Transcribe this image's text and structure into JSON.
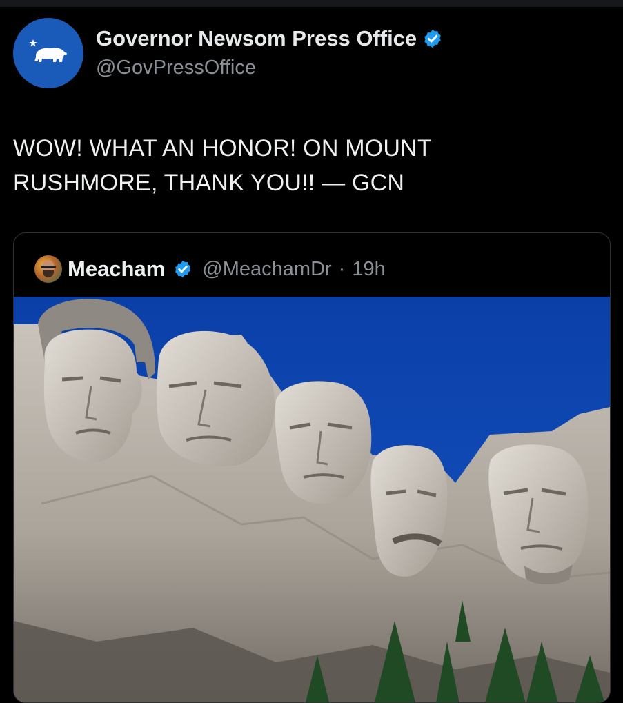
{
  "tweet": {
    "author_name": "Governor Newsom Press Office",
    "author_handle": "@GovPressOffice",
    "text_line_1": "WOW! WHAT AN HONOR! ON MOUNT",
    "text_line_2": "RUSHMORE, THANK YOU!! — GCN"
  },
  "quote": {
    "author_name": "Meacham",
    "author_handle": "@MeachamDr",
    "separator": "·",
    "time": "19h"
  },
  "icons": {
    "avatar": "california-bear-icon",
    "verified": "verified-badge-icon"
  },
  "colors": {
    "background": "#000000",
    "verified": "#1d9bf0",
    "avatar_blue": "#1a5ab8",
    "sky": "#0d47b6",
    "muted_text": "#8b9096"
  }
}
